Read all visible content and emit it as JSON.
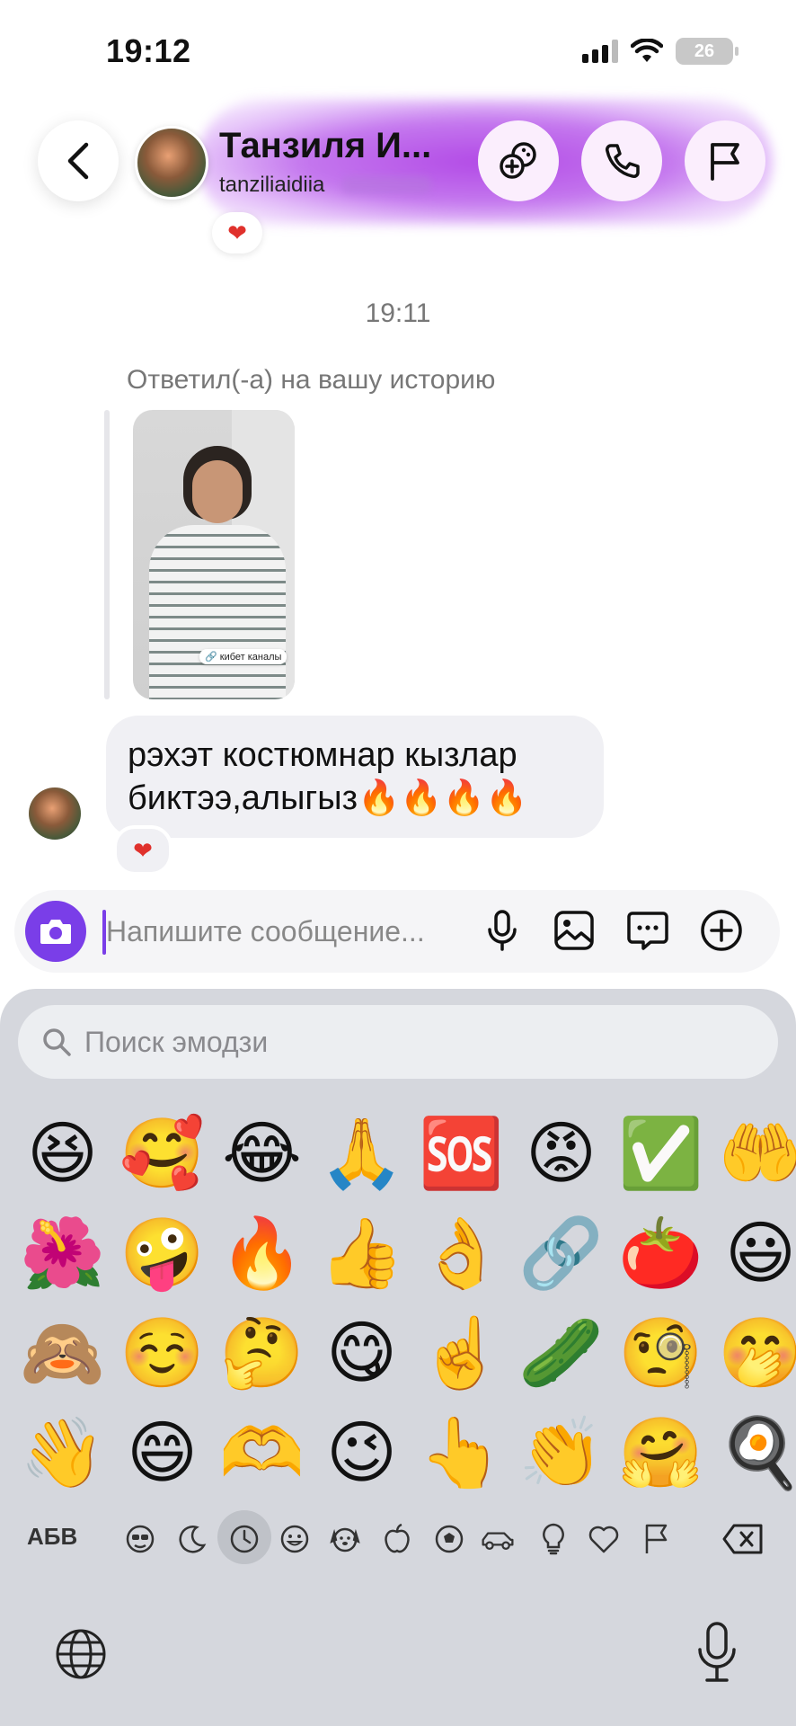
{
  "status_bar": {
    "time": "19:12",
    "battery": "26"
  },
  "header": {
    "contact_name": "Танзиля И...",
    "username": "tanziliaidiia",
    "reaction": "❤"
  },
  "chat": {
    "timestamp": "19:11",
    "reply_label": "Ответил(-а) на вашу историю",
    "story_tag": "🔗 кибет каналы",
    "message_text": "рэхэт костюмнар кызлар биктээ,алыгыз🔥🔥🔥🔥",
    "message_reaction": "❤"
  },
  "composer": {
    "placeholder": "Напишите сообщение..."
  },
  "keyboard": {
    "search_placeholder": "Поиск эмодзи",
    "abc_label": "АБВ",
    "emojis": [
      "😆",
      "🥰",
      "😂",
      "🙏",
      "🆘",
      "😡",
      "✅",
      "🤲",
      "🌺",
      "🤪",
      "🔥",
      "👍",
      "👌",
      "🔗",
      "🍅",
      "😃",
      "🙈",
      "☺️",
      "🤔",
      "😋",
      "☝️",
      "🥒",
      "🧐",
      "🤭",
      "👋",
      "😄",
      "🫶",
      "😉",
      "👆",
      "👏",
      "🤗",
      "🍳"
    ],
    "categories": [
      "smileys-people",
      "animals-nature-moon",
      "recent",
      "smileys",
      "animals",
      "food",
      "activity",
      "travel",
      "objects",
      "symbols",
      "flags"
    ]
  },
  "colors": {
    "accent": "#7a3ee8",
    "header_glow": "#b24ae6",
    "keyboard_bg": "#d5d7dd"
  }
}
